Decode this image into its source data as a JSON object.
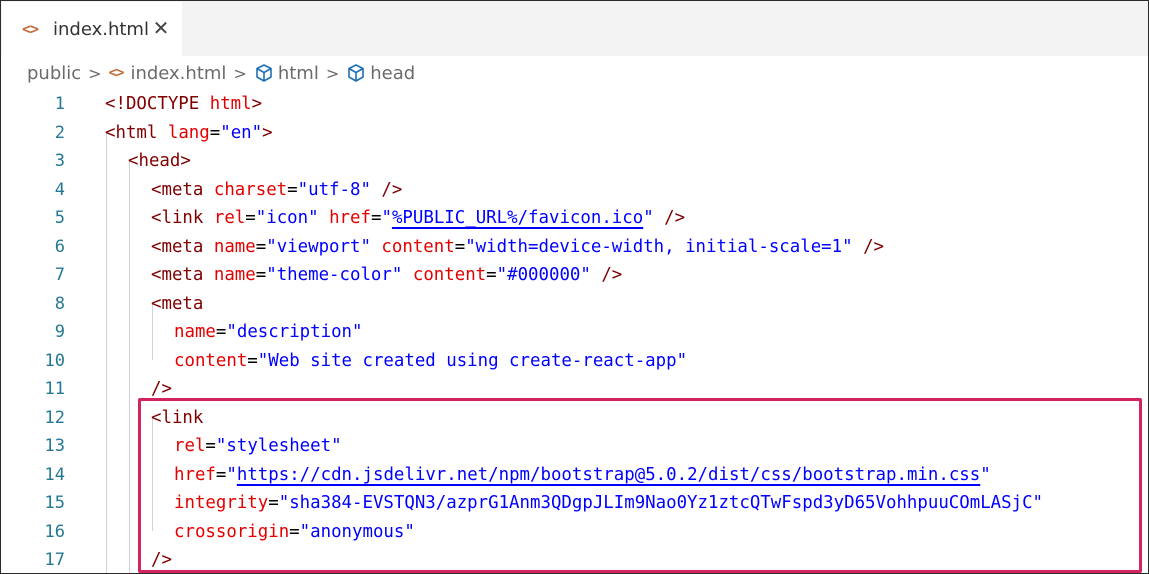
{
  "tab": {
    "icon": "<>",
    "icon_name": "code-icon",
    "label": "index.html",
    "close": "✕"
  },
  "breadcrumb": {
    "items": [
      {
        "label": "public",
        "icon": null
      },
      {
        "label": "index.html",
        "icon": "<>"
      },
      {
        "label": "html",
        "icon": "cube"
      },
      {
        "label": "head",
        "icon": "cube"
      }
    ],
    "separator": ">"
  },
  "editor": {
    "line_numbers": [
      "1",
      "2",
      "3",
      "4",
      "5",
      "6",
      "7",
      "8",
      "9",
      "10",
      "11",
      "12",
      "13",
      "14",
      "15",
      "16",
      "17"
    ],
    "highlighted_lines": [
      12,
      17
    ],
    "colors": {
      "tag": "#800000",
      "attribute": "#e50000",
      "string": "#0000ff",
      "line_number": "#237893",
      "highlight": "#d3245f"
    }
  },
  "code": {
    "l1": {
      "open": "<!",
      "doctype": "DOCTYPE",
      "sp": " ",
      "html": "html",
      "close": ">"
    },
    "l2": {
      "open": "<",
      "tag": "html",
      "sp": " ",
      "attr": "lang",
      "eq": "=",
      "val": "\"en\"",
      "close": ">"
    },
    "l3": {
      "open": "<",
      "tag": "head",
      "close": ">"
    },
    "l4": {
      "open": "<",
      "tag": "meta",
      "sp": " ",
      "attr": "charset",
      "eq": "=",
      "val": "\"utf-8\"",
      "close": " />"
    },
    "l5": {
      "open": "<",
      "tag": "link",
      "sp": " ",
      "attr1": "rel",
      "eq1": "=",
      "val1": "\"icon\"",
      "sp2": " ",
      "attr2": "href",
      "eq2": "=",
      "q1": "\"",
      "url": "%PUBLIC_URL%/favicon.ico",
      "q2": "\"",
      "close": " />"
    },
    "l6": {
      "open": "<",
      "tag": "meta",
      "sp": " ",
      "attr1": "name",
      "eq1": "=",
      "val1": "\"viewport\"",
      "sp2": " ",
      "attr2": "content",
      "eq2": "=",
      "val2": "\"width=device-width, initial-scale=1\"",
      "close": " />"
    },
    "l7": {
      "open": "<",
      "tag": "meta",
      "sp": " ",
      "attr1": "name",
      "eq1": "=",
      "val1": "\"theme-color\"",
      "sp2": " ",
      "attr2": "content",
      "eq2": "=",
      "val2": "\"#000000\"",
      "close": " />"
    },
    "l8": {
      "open": "<",
      "tag": "meta"
    },
    "l9": {
      "attr": "name",
      "eq": "=",
      "val": "\"description\""
    },
    "l10": {
      "attr": "content",
      "eq": "=",
      "val": "\"Web site created using create-react-app\""
    },
    "l11": {
      "close": "/>"
    },
    "l12": {
      "open": "<",
      "tag": "link"
    },
    "l13": {
      "attr": "rel",
      "eq": "=",
      "val": "\"stylesheet\""
    },
    "l14": {
      "attr": "href",
      "eq": "=",
      "q1": "\"",
      "url": "https://cdn.jsdelivr.net/npm/bootstrap@5.0.2/dist/css/bootstrap.min.css",
      "q2": "\""
    },
    "l15": {
      "attr": "integrity",
      "eq": "=",
      "val": "\"sha384-EVSTQN3/azprG1Anm3QDgpJLIm9Nao0Yz1ztcQTwFspd3yD65VohhpuuCOmLASjC\""
    },
    "l16": {
      "attr": "crossorigin",
      "eq": "=",
      "val": "\"anonymous\""
    },
    "l17": {
      "close": "/>"
    }
  }
}
